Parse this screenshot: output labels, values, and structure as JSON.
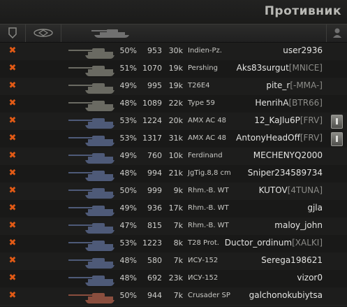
{
  "title": "Противник",
  "header": {
    "icons": [
      "shield-icon",
      "vehicle-class-icon",
      "tank-silhouette-icon",
      "player-icon"
    ]
  },
  "rows": [
    {
      "status": "destroyed",
      "tank_color": "#6a6a62",
      "winrate": "50%",
      "battles": "953",
      "damage": "30k",
      "tank": "Indien-Pz.",
      "player": "user2936",
      "clan": "",
      "squad": false
    },
    {
      "status": "destroyed",
      "tank_color": "#6a6a62",
      "winrate": "51%",
      "battles": "1070",
      "damage": "19k",
      "tank": "Pershing",
      "player": "Aks83surgut",
      "clan": "[MNICE]",
      "squad": false
    },
    {
      "status": "destroyed",
      "tank_color": "#6a6a62",
      "winrate": "49%",
      "battles": "995",
      "damage": "19k",
      "tank": "T26E4",
      "player": "pite_r",
      "clan": "[-MMA-]",
      "squad": false
    },
    {
      "status": "destroyed",
      "tank_color": "#6a6a62",
      "winrate": "48%",
      "battles": "1089",
      "damage": "22k",
      "tank": "Type 59",
      "player": "HenrihA",
      "clan": "[BTR66]",
      "squad": false
    },
    {
      "status": "destroyed",
      "tank_color": "#4e5a78",
      "winrate": "53%",
      "battles": "1224",
      "damage": "20k",
      "tank": "AMX AC 48",
      "player": "12_KaJlu6P",
      "clan": "[FRV]",
      "squad": true
    },
    {
      "status": "destroyed",
      "tank_color": "#4e5a78",
      "winrate": "53%",
      "battles": "1317",
      "damage": "31k",
      "tank": "AMX AC 48",
      "player": "AntonyHeadOff",
      "clan": "[FRV]",
      "squad": true
    },
    {
      "status": "destroyed",
      "tank_color": "#4e5a78",
      "winrate": "49%",
      "battles": "760",
      "damage": "10k",
      "tank": "Ferdinand",
      "player": "MECHENYQ2000",
      "clan": "",
      "squad": false
    },
    {
      "status": "destroyed",
      "tank_color": "#4e5a78",
      "winrate": "48%",
      "battles": "994",
      "damage": "21k",
      "tank": "JgTig.8,8 cm",
      "player": "Sniper234589734",
      "clan": "",
      "squad": false
    },
    {
      "status": "destroyed",
      "tank_color": "#4e5a78",
      "winrate": "50%",
      "battles": "999",
      "damage": "9k",
      "tank": "Rhm.-B. WT",
      "player": "KUTOV",
      "clan": "[4TUNA]",
      "squad": false
    },
    {
      "status": "destroyed",
      "tank_color": "#4e5a78",
      "winrate": "49%",
      "battles": "936",
      "damage": "17k",
      "tank": "Rhm.-B. WT",
      "player": "gjla",
      "clan": "",
      "squad": false
    },
    {
      "status": "destroyed",
      "tank_color": "#4e5a78",
      "winrate": "47%",
      "battles": "815",
      "damage": "7k",
      "tank": "Rhm.-B. WT",
      "player": "maloy_john",
      "clan": "",
      "squad": false
    },
    {
      "status": "destroyed",
      "tank_color": "#4e5a78",
      "winrate": "53%",
      "battles": "1223",
      "damage": "8k",
      "tank": "T28 Prot.",
      "player": "Ductor_ordinum",
      "clan": "[XALKI]",
      "squad": false
    },
    {
      "status": "destroyed",
      "tank_color": "#4e5a78",
      "winrate": "48%",
      "battles": "580",
      "damage": "7k",
      "tank": "ИСУ-152",
      "player": "Serega198621",
      "clan": "",
      "squad": false
    },
    {
      "status": "destroyed",
      "tank_color": "#4e5a78",
      "winrate": "48%",
      "battles": "692",
      "damage": "23k",
      "tank": "ИСУ-152",
      "player": "vizor0",
      "clan": "",
      "squad": false
    },
    {
      "status": "destroyed",
      "tank_color": "#8a4e3e",
      "winrate": "50%",
      "battles": "944",
      "damage": "7k",
      "tank": "Crusader SP",
      "player": "galchonokubiytsa",
      "clan": "",
      "squad": false
    }
  ]
}
